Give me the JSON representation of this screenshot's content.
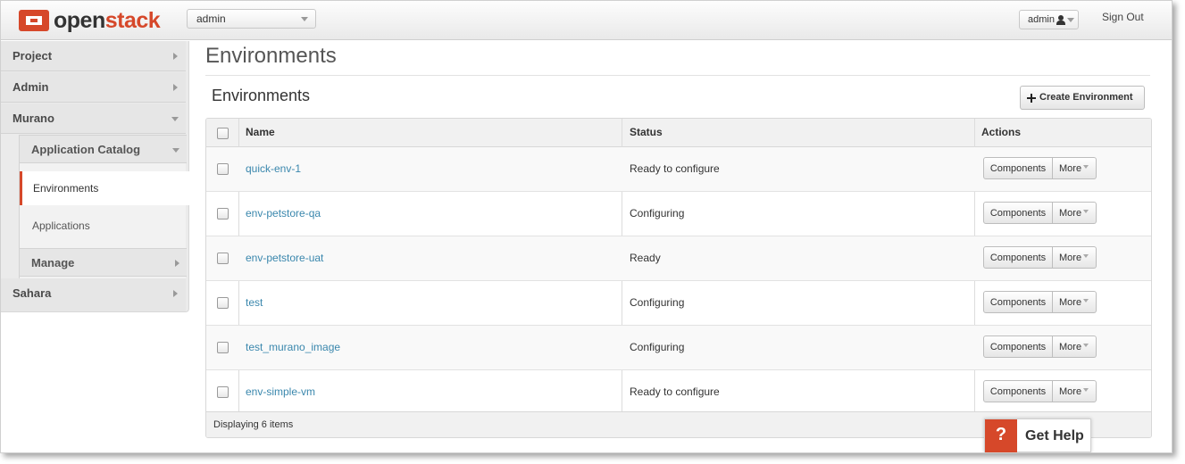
{
  "header": {
    "logo_open": "open",
    "logo_stack": "stack",
    "project": "admin",
    "user": "admin",
    "sign_out": "Sign Out"
  },
  "sidebar": {
    "dashboards": [
      "Project",
      "Admin",
      "Murano",
      "Sahara"
    ],
    "murano_panel_group": "Application Catalog",
    "murano_items": [
      "Environments",
      "Applications"
    ],
    "manage_group": "Manage"
  },
  "main": {
    "page_title": "Environments",
    "table_title": "Environments",
    "create_button": "Create Environment",
    "columns": [
      "Name",
      "Status",
      "Actions"
    ],
    "rows": [
      {
        "name": "quick-env-1",
        "status": "Ready to configure"
      },
      {
        "name": "env-petstore-qa",
        "status": "Configuring"
      },
      {
        "name": "env-petstore-uat",
        "status": "Ready"
      },
      {
        "name": "test",
        "status": "Configuring"
      },
      {
        "name": "test_murano_image",
        "status": "Configuring"
      },
      {
        "name": "env-simple-vm",
        "status": "Ready to configure"
      }
    ],
    "row_actions": {
      "components": "Components",
      "more": "More"
    },
    "footer": "Displaying 6 items"
  },
  "help_widget": {
    "icon_text": "?",
    "label": "Get Help"
  },
  "colors": {
    "brand": "#d6482a",
    "link": "#3a87ad"
  }
}
